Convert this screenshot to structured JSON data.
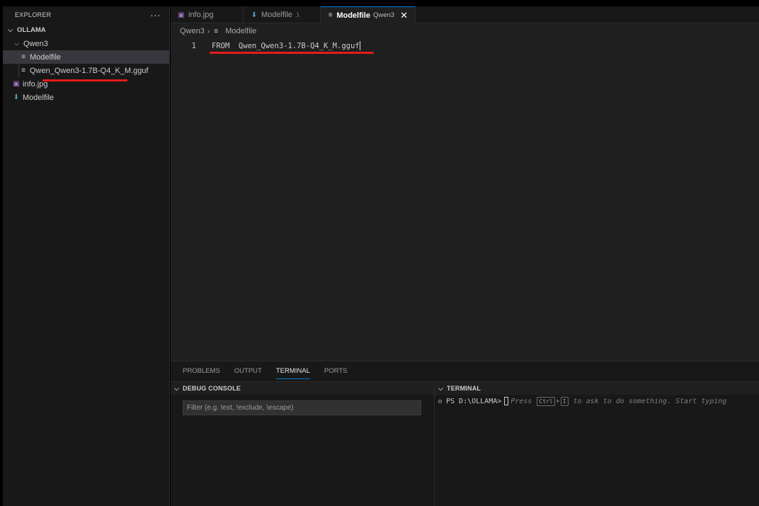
{
  "explorer": {
    "title": "EXPLORER",
    "more_label": "···",
    "root": "OLLAMA",
    "items": [
      {
        "label": "Qwen3",
        "kind": "folder"
      },
      {
        "label": "Modelfile",
        "kind": "file"
      },
      {
        "label": "Qwen_Qwen3-1.7B-Q4_K_M.gguf",
        "kind": "file"
      },
      {
        "label": "info.jpg",
        "kind": "image"
      },
      {
        "label": "Modelfile",
        "kind": "modelfile"
      }
    ]
  },
  "tabs": [
    {
      "label": "info.jpg",
      "desc": "",
      "icon": "image-icon"
    },
    {
      "label": "Modelfile",
      "desc": ".\\",
      "icon": "download-arrow-icon"
    },
    {
      "label": "Modelfile",
      "desc": "Qwen3",
      "icon": "lines-icon",
      "active": true,
      "close": "✕"
    }
  ],
  "breadcrumb": {
    "folder": "Qwen3",
    "sep": "›",
    "file": "Modelfile"
  },
  "editor": {
    "lines": [
      {
        "number": "1",
        "text": "FROM  Qwen_Qwen3-1.7B-Q4_K_M.gguf"
      }
    ]
  },
  "panel": {
    "tabs": [
      "PROBLEMS",
      "OUTPUT",
      "TERMINAL",
      "PORTS"
    ],
    "active_tab": "TERMINAL",
    "debug_header": "DEBUG CONSOLE",
    "filter_placeholder": "Filter (e.g. text, !exclude, \\escape)",
    "terminal_header": "TERMINAL",
    "prompt": "PS D:\\OLLAMA>",
    "hint_press": "Press",
    "hint_key1": "Ctrl",
    "hint_plus": "+",
    "hint_key2": "I",
    "hint_rest": "to ask to do something. Start typing"
  },
  "colors": {
    "accent": "#0078d4",
    "annotation_red": "#e51b1b"
  }
}
